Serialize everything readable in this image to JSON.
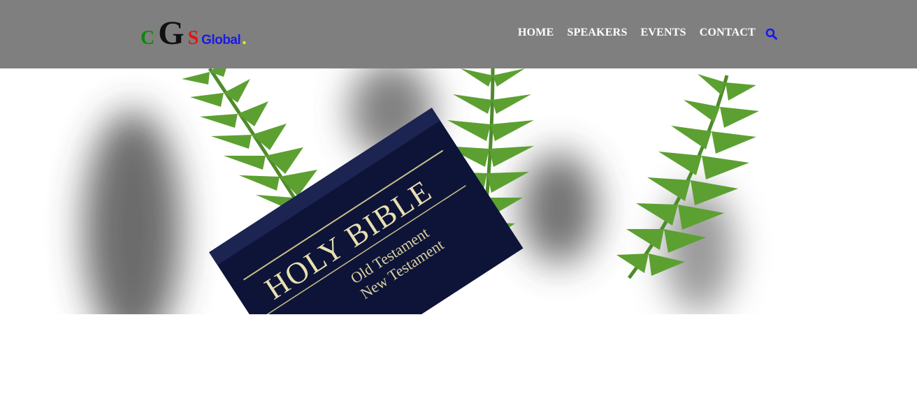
{
  "logo": {
    "c": "C",
    "g": "G",
    "s": "S",
    "global": "Global",
    "dot": "."
  },
  "nav": [
    {
      "label": "HOME"
    },
    {
      "label": "SPEAKERS"
    },
    {
      "label": "EVENTS"
    },
    {
      "label": "CONTACT"
    }
  ],
  "search_icon": "search-icon",
  "hero": {
    "book_title": "HOLY BIBLE",
    "book_line1": "Old Testament",
    "book_line2": "New Testament"
  },
  "colors": {
    "header_bg": "#7f7f7f",
    "logo_c": "#0a8a0a",
    "logo_g": "#111111",
    "logo_s": "#e31414",
    "logo_global": "#1a1ae6",
    "logo_dot": "#f0f000",
    "search": "#1a1ae6"
  }
}
